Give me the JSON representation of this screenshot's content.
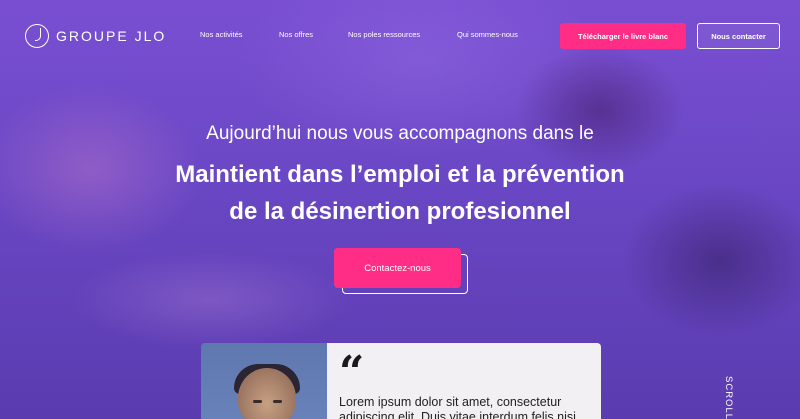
{
  "brand": {
    "name": "GROUPE JLO"
  },
  "nav": {
    "links": [
      "Nos activités",
      "Nos offres",
      "Nos poles ressources",
      "Qui sommes-nous"
    ],
    "download_label": "Télécharger le livre blanc",
    "contact_label": "Nous contacter"
  },
  "hero": {
    "subtitle": "Aujourd’hui nous vous accompagnons dans le",
    "title_line1": "Maintient dans l’emploi et la prévention",
    "title_line2": "de la désinertion profesionnel",
    "cta_label": "Contactez-nous"
  },
  "testimonial": {
    "quote_mark": "“",
    "text": "Lorem ipsum dolor sit amet, consectetur adipiscing elit. Duis vitae interdum felis nisi"
  },
  "scroll_label": "SCROLL",
  "colors": {
    "accent": "#ff2d86",
    "hero_purple": "#6a47c4"
  }
}
